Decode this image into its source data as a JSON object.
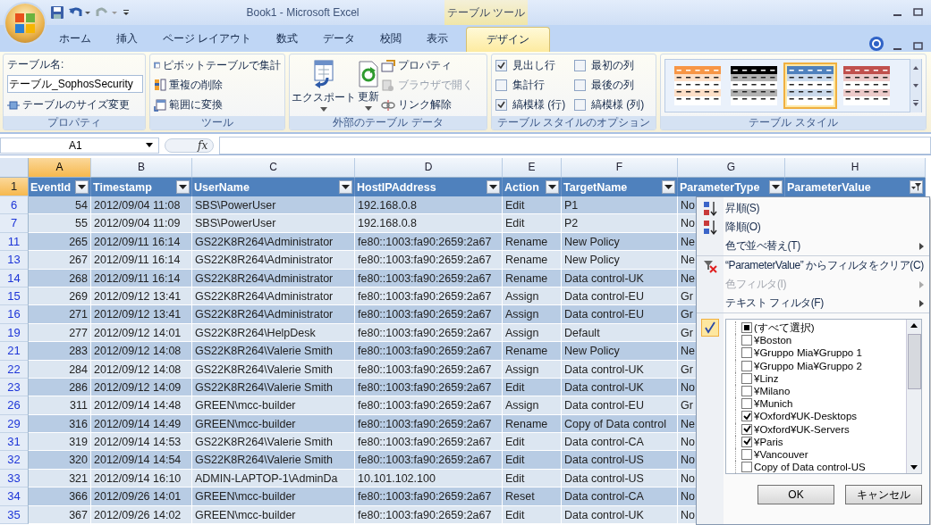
{
  "title_bar": {
    "title": "Book1 - Microsoft Excel",
    "context_tab": "テーブル ツール"
  },
  "ribbon_tabs": [
    {
      "label": "ホーム",
      "selected": false
    },
    {
      "label": "挿入",
      "selected": false
    },
    {
      "label": "ページ レイアウト",
      "selected": false
    },
    {
      "label": "数式",
      "selected": false
    },
    {
      "label": "データ",
      "selected": false
    },
    {
      "label": "校閲",
      "selected": false
    },
    {
      "label": "表示",
      "selected": false
    },
    {
      "label": "デザイン",
      "selected": true
    }
  ],
  "ribbon": {
    "properties": {
      "name_label": "テーブル名:",
      "table_name": "テーブル_SophosSecurity",
      "resize": "テーブルのサイズ変更",
      "group": "プロパティ"
    },
    "tools": {
      "items": [
        "ピボットテーブルで集計",
        "重複の削除",
        "範囲に変換"
      ],
      "group": "ツール"
    },
    "external": {
      "export": "エクスポート",
      "refresh": "更新",
      "items": [
        {
          "label": "プロパティ",
          "disabled": false
        },
        {
          "label": "ブラウザで開く",
          "disabled": true
        },
        {
          "label": "リンク解除",
          "disabled": false
        }
      ],
      "group": "外部のテーブル データ"
    },
    "style_options": {
      "options": [
        {
          "label": "見出し行",
          "checked": true
        },
        {
          "label": "最初の列",
          "checked": false
        },
        {
          "label": "集計行",
          "checked": false
        },
        {
          "label": "最後の列",
          "checked": false
        },
        {
          "label": "縞模様 (行)",
          "checked": true
        },
        {
          "label": "縞模様 (列)",
          "checked": false
        }
      ],
      "group": "テーブル スタイルのオプション"
    },
    "styles": {
      "swatches": [
        {
          "color": "#f79646",
          "selected": false
        },
        {
          "color": "#000000",
          "selected": false
        },
        {
          "color": "#4f81bd",
          "selected": true
        },
        {
          "color": "#c0504d",
          "selected": false
        }
      ],
      "group": "テーブル スタイル"
    }
  },
  "formula_bar": {
    "name_box": "A1",
    "fx_label": "fx"
  },
  "sheet": {
    "columns": [
      {
        "letter": "A",
        "selected": true
      },
      {
        "letter": "B",
        "selected": false
      },
      {
        "letter": "C",
        "selected": false
      },
      {
        "letter": "D",
        "selected": false
      },
      {
        "letter": "E",
        "selected": false
      },
      {
        "letter": "F",
        "selected": false
      },
      {
        "letter": "G",
        "selected": false
      },
      {
        "letter": "H",
        "selected": false
      }
    ],
    "header_row": "1",
    "headers": [
      {
        "label": "EventId",
        "filtered": false
      },
      {
        "label": "Timestamp",
        "filtered": false
      },
      {
        "label": "UserName",
        "filtered": false
      },
      {
        "label": "HostIPAddress",
        "filtered": false
      },
      {
        "label": "Action",
        "filtered": false
      },
      {
        "label": "TargetName",
        "filtered": false
      },
      {
        "label": "ParameterType",
        "filtered": false
      },
      {
        "label": "ParameterValue",
        "filtered": true
      }
    ],
    "rows": [
      {
        "num": "6",
        "cells": [
          "54",
          "2012/09/04 11:08",
          "SBS\\PowerUser",
          "192.168.0.8",
          "Edit",
          "P1",
          "No"
        ]
      },
      {
        "num": "7",
        "cells": [
          "55",
          "2012/09/04 11:09",
          "SBS\\PowerUser",
          "192.168.0.8",
          "Edit",
          "P2",
          "No"
        ]
      },
      {
        "num": "11",
        "cells": [
          "265",
          "2012/09/11 16:14",
          "GS22K8R264\\Administrator",
          "fe80::1003:fa90:2659:2a67",
          "Rename",
          "New Policy",
          "Ne"
        ]
      },
      {
        "num": "13",
        "cells": [
          "267",
          "2012/09/11 16:14",
          "GS22K8R264\\Administrator",
          "fe80::1003:fa90:2659:2a67",
          "Rename",
          "New Policy",
          "Ne"
        ]
      },
      {
        "num": "14",
        "cells": [
          "268",
          "2012/09/11 16:14",
          "GS22K8R264\\Administrator",
          "fe80::1003:fa90:2659:2a67",
          "Rename",
          "Data control-UK",
          "Ne"
        ]
      },
      {
        "num": "15",
        "cells": [
          "269",
          "2012/09/12 13:41",
          "GS22K8R264\\Administrator",
          "fe80::1003:fa90:2659:2a67",
          "Assign",
          "Data control-EU",
          "Gr"
        ]
      },
      {
        "num": "16",
        "cells": [
          "271",
          "2012/09/12 13:41",
          "GS22K8R264\\Administrator",
          "fe80::1003:fa90:2659:2a67",
          "Assign",
          "Data control-EU",
          "Gr"
        ]
      },
      {
        "num": "19",
        "cells": [
          "277",
          "2012/09/12 14:01",
          "GS22K8R264\\HelpDesk",
          "fe80::1003:fa90:2659:2a67",
          "Assign",
          "Default",
          "Gr"
        ]
      },
      {
        "num": "21",
        "cells": [
          "283",
          "2012/09/12 14:08",
          "GS22K8R264\\Valerie Smith",
          "fe80::1003:fa90:2659:2a67",
          "Rename",
          "New Policy",
          "Ne"
        ]
      },
      {
        "num": "22",
        "cells": [
          "284",
          "2012/09/12 14:08",
          "GS22K8R264\\Valerie Smith",
          "fe80::1003:fa90:2659:2a67",
          "Assign",
          "Data control-UK",
          "Gr"
        ]
      },
      {
        "num": "23",
        "cells": [
          "286",
          "2012/09/12 14:09",
          "GS22K8R264\\Valerie Smith",
          "fe80::1003:fa90:2659:2a67",
          "Edit",
          "Data control-UK",
          "No"
        ]
      },
      {
        "num": "26",
        "cells": [
          "311",
          "2012/09/14 14:48",
          "GREEN\\mcc-builder",
          "fe80::1003:fa90:2659:2a67",
          "Assign",
          "Data control-EU",
          "Gr"
        ]
      },
      {
        "num": "29",
        "cells": [
          "316",
          "2012/09/14 14:49",
          "GREEN\\mcc-builder",
          "fe80::1003:fa90:2659:2a67",
          "Rename",
          "Copy of Data control",
          "Ne"
        ]
      },
      {
        "num": "31",
        "cells": [
          "319",
          "2012/09/14 14:53",
          "GS22K8R264\\Valerie Smith",
          "fe80::1003:fa90:2659:2a67",
          "Edit",
          "Data control-CA",
          "No"
        ]
      },
      {
        "num": "32",
        "cells": [
          "320",
          "2012/09/14 14:54",
          "GS22K8R264\\Valerie Smith",
          "fe80::1003:fa90:2659:2a67",
          "Edit",
          "Data control-US",
          "No"
        ]
      },
      {
        "num": "33",
        "cells": [
          "321",
          "2012/09/14 16:10",
          "ADMIN-LAPTOP-1\\AdminDa",
          "10.101.102.100",
          "Edit",
          "Data control-US",
          "No"
        ]
      },
      {
        "num": "34",
        "cells": [
          "366",
          "2012/09/26 14:01",
          "GREEN\\mcc-builder",
          "fe80::1003:fa90:2659:2a67",
          "Reset",
          "Data control-CA",
          "No"
        ]
      },
      {
        "num": "35",
        "cells": [
          "367",
          "2012/09/26 14:02",
          "GREEN\\mcc-builder",
          "fe80::1003:fa90:2659:2a67",
          "Edit",
          "Data control-UK",
          "No"
        ]
      }
    ]
  },
  "filter_menu": {
    "items": [
      {
        "kind": "sort-asc",
        "label": "昇順(S)",
        "disabled": false,
        "submenu": false,
        "divider_before": false
      },
      {
        "kind": "sort-desc",
        "label": "降順(O)",
        "disabled": false,
        "submenu": false,
        "divider_before": false
      },
      {
        "kind": "plain",
        "label": "色で並べ替え(T)",
        "disabled": false,
        "submenu": true,
        "divider_before": false
      },
      {
        "kind": "clear",
        "label": "“ParameterValue” からフィルタをクリア(C)",
        "disabled": false,
        "submenu": false,
        "divider_before": true
      },
      {
        "kind": "plain",
        "label": "色フィルタ(I)",
        "disabled": true,
        "submenu": true,
        "divider_before": false
      },
      {
        "kind": "plain",
        "label": "テキスト フィルタ(F)",
        "disabled": false,
        "submenu": true,
        "divider_before": false
      }
    ],
    "value_filter_active": true,
    "select_all": {
      "label": "(すべて選択)",
      "partial": true
    },
    "values": [
      {
        "label": "¥Boston",
        "checked": false
      },
      {
        "label": "¥Gruppo Mia¥Gruppo 1",
        "checked": false
      },
      {
        "label": "¥Gruppo Mia¥Gruppo 2",
        "checked": false
      },
      {
        "label": "¥Linz",
        "checked": false
      },
      {
        "label": "¥Milano",
        "checked": false
      },
      {
        "label": "¥Munich",
        "checked": false
      },
      {
        "label": "¥Oxford¥UK-Desktops",
        "checked": true
      },
      {
        "label": "¥Oxford¥UK-Servers",
        "checked": true
      },
      {
        "label": "¥Paris",
        "checked": true
      },
      {
        "label": "¥Vancouver",
        "checked": false
      },
      {
        "label": "Copy of Data control-US",
        "checked": false
      }
    ],
    "buttons": [
      "OK",
      "キャンセル"
    ]
  }
}
